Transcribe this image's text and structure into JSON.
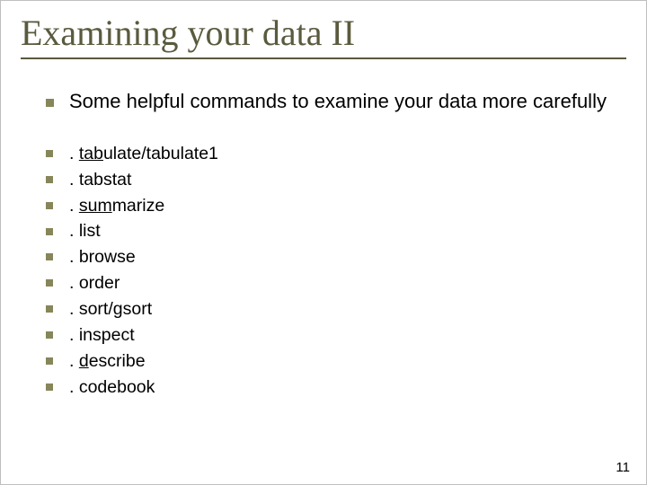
{
  "title": "Examining your data II",
  "intro": "Some helpful commands to examine your data more carefully",
  "items": [
    {
      "pre": ". ",
      "u": "tab",
      "post": "ulate/tabulate1"
    },
    {
      "pre": ". tabstat",
      "u": "",
      "post": ""
    },
    {
      "pre": ". ",
      "u": "sum",
      "post": "marize"
    },
    {
      "pre": ". list",
      "u": "",
      "post": ""
    },
    {
      "pre": ". browse",
      "u": "",
      "post": ""
    },
    {
      "pre": ". order",
      "u": "",
      "post": ""
    },
    {
      "pre": ". sort/gsort",
      "u": "",
      "post": ""
    },
    {
      "pre": ". inspect",
      "u": "",
      "post": ""
    },
    {
      "pre": ". ",
      "u": "d",
      "post": "escribe"
    },
    {
      "pre": ". codebook",
      "u": "",
      "post": ""
    }
  ],
  "page": "11"
}
